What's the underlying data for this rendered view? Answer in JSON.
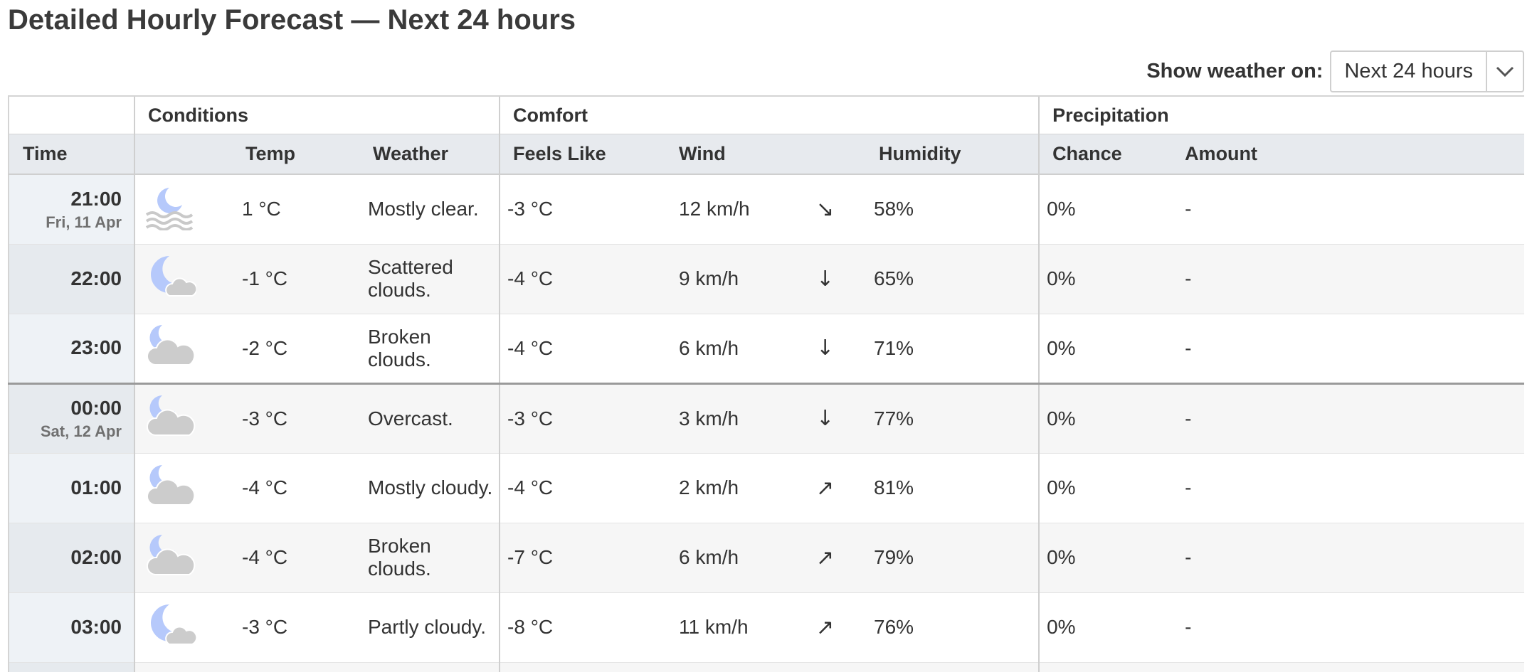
{
  "page_title": "Detailed Hourly Forecast — Next 24 hours",
  "selector": {
    "label": "Show weather on:",
    "value": "Next 24 hours"
  },
  "groups": {
    "conditions": "Conditions",
    "comfort": "Comfort",
    "precipitation": "Precipitation"
  },
  "columns": {
    "time": "Time",
    "temp": "Temp",
    "weather": "Weather",
    "feels_like": "Feels Like",
    "wind": "Wind",
    "humidity": "Humidity",
    "chance": "Chance",
    "amount": "Amount"
  },
  "rows": [
    {
      "time": "21:00",
      "date": "Fri, 11 Apr",
      "icon": "clear-night-fog-icon",
      "temp": "1 °C",
      "weather": "Mostly clear.",
      "feels": "-3 °C",
      "wind": "12 km/h",
      "wind_arrow": "↘",
      "humidity": "58%",
      "chance": "0%",
      "amount": "-"
    },
    {
      "time": "22:00",
      "date": "",
      "icon": "moon-small-cloud-icon",
      "temp": "-1 °C",
      "weather": "Scattered clouds.",
      "feels": "-4 °C",
      "wind": "9 km/h",
      "wind_arrow": "↓",
      "humidity": "65%",
      "chance": "0%",
      "amount": "-"
    },
    {
      "time": "23:00",
      "date": "",
      "icon": "moon-cloud-icon",
      "temp": "-2 °C",
      "weather": "Broken clouds.",
      "feels": "-4 °C",
      "wind": "6 km/h",
      "wind_arrow": "↓",
      "humidity": "71%",
      "chance": "0%",
      "amount": "-"
    },
    {
      "time": "00:00",
      "date": "Sat, 12 Apr",
      "icon": "moon-cloud-icon",
      "temp": "-3 °C",
      "weather": "Overcast.",
      "feels": "-3 °C",
      "wind": "3 km/h",
      "wind_arrow": "↓",
      "humidity": "77%",
      "chance": "0%",
      "amount": "-"
    },
    {
      "time": "01:00",
      "date": "",
      "icon": "moon-cloud-icon",
      "temp": "-4 °C",
      "weather": "Mostly cloudy.",
      "feels": "-4 °C",
      "wind": "2 km/h",
      "wind_arrow": "↗",
      "humidity": "81%",
      "chance": "0%",
      "amount": "-"
    },
    {
      "time": "02:00",
      "date": "",
      "icon": "moon-cloud-icon",
      "temp": "-4 °C",
      "weather": "Broken clouds.",
      "feels": "-7 °C",
      "wind": "6 km/h",
      "wind_arrow": "↗",
      "humidity": "79%",
      "chance": "0%",
      "amount": "-"
    },
    {
      "time": "03:00",
      "date": "",
      "icon": "moon-small-cloud-icon",
      "temp": "-3 °C",
      "weather": "Partly cloudy.",
      "feels": "-8 °C",
      "wind": "11 km/h",
      "wind_arrow": "↗",
      "humidity": "76%",
      "chance": "0%",
      "amount": "-"
    }
  ],
  "colors": {
    "moon": "#b6c9fb",
    "cloud": "#cccccc",
    "header_bg": "#e7eaee"
  }
}
